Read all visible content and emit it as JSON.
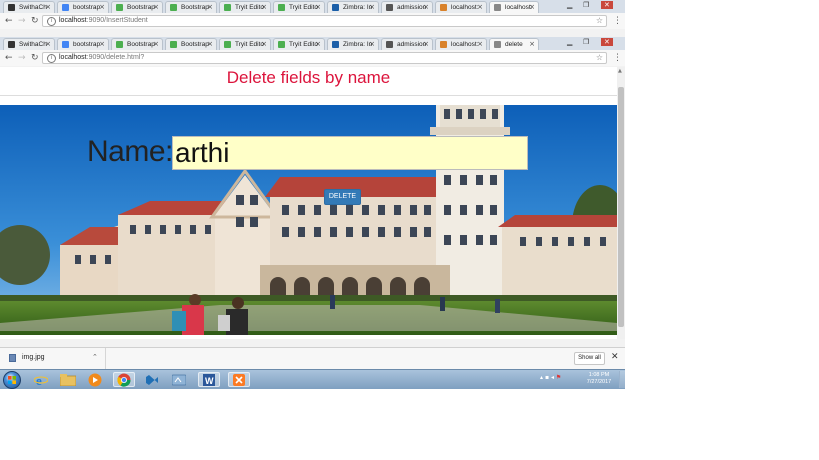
{
  "window_back": {
    "tabs": [
      {
        "label": "SwithaCh",
        "favicon": "github-icon",
        "color": "#333333"
      },
      {
        "label": "bootstrap",
        "favicon": "google-icon",
        "color": "#4285f4"
      },
      {
        "label": "Bootstrap",
        "favicon": "w3schools-icon",
        "color": "#4caf50"
      },
      {
        "label": "Bootstrap",
        "favicon": "w3schools-icon",
        "color": "#4caf50"
      },
      {
        "label": "Tryit Edito",
        "favicon": "w3schools-icon",
        "color": "#4caf50"
      },
      {
        "label": "Tryit Edito",
        "favicon": "w3schools-icon",
        "color": "#4caf50"
      },
      {
        "label": "Zimbra: In",
        "favicon": "zimbra-icon",
        "color": "#1a5ea8"
      },
      {
        "label": "admission",
        "favicon": "upload-icon",
        "color": "#555555"
      },
      {
        "label": "localhost:",
        "favicon": "chart-icon",
        "color": "#d9822b"
      },
      {
        "label": "localhost:",
        "favicon": "page-icon",
        "color": "#888888",
        "active": true
      }
    ],
    "url": {
      "host": "localhost",
      "path": ":9090/InsertStudent"
    }
  },
  "window_front": {
    "tabs": [
      {
        "label": "SwithaCh",
        "favicon": "github-icon",
        "color": "#333333"
      },
      {
        "label": "bootstrap",
        "favicon": "google-icon",
        "color": "#4285f4"
      },
      {
        "label": "Bootstrap",
        "favicon": "w3schools-icon",
        "color": "#4caf50"
      },
      {
        "label": "Bootstrap",
        "favicon": "w3schools-icon",
        "color": "#4caf50"
      },
      {
        "label": "Tryit Edito",
        "favicon": "w3schools-icon",
        "color": "#4caf50"
      },
      {
        "label": "Tryit Edito",
        "favicon": "w3schools-icon",
        "color": "#4caf50"
      },
      {
        "label": "Zimbra: In",
        "favicon": "zimbra-icon",
        "color": "#1a5ea8"
      },
      {
        "label": "admission",
        "favicon": "upload-icon",
        "color": "#555555"
      },
      {
        "label": "localhost:",
        "favicon": "chart-icon",
        "color": "#d9822b"
      },
      {
        "label": "delete",
        "favicon": "page-icon",
        "color": "#888888",
        "active": true
      }
    ],
    "url": {
      "host": "localhost",
      "path": ":9090/delete.html?"
    }
  },
  "page": {
    "title": "Delete fields by name",
    "title_color": "#dc143c",
    "name_label": "Name:",
    "name_value": "arthi",
    "delete_button": "DELETE"
  },
  "downloads": {
    "file_name": "img.jpg",
    "show_all": "Show all"
  },
  "taskbar": {
    "apps": [
      {
        "name": "internet-explorer-icon"
      },
      {
        "name": "file-explorer-icon"
      },
      {
        "name": "media-player-icon"
      },
      {
        "name": "chrome-icon",
        "active": true
      },
      {
        "name": "visual-studio-icon"
      },
      {
        "name": "generic-app-icon"
      },
      {
        "name": "word-icon"
      },
      {
        "name": "xampp-icon"
      }
    ],
    "time": "1:08 PM",
    "date": "7/27/2017"
  }
}
